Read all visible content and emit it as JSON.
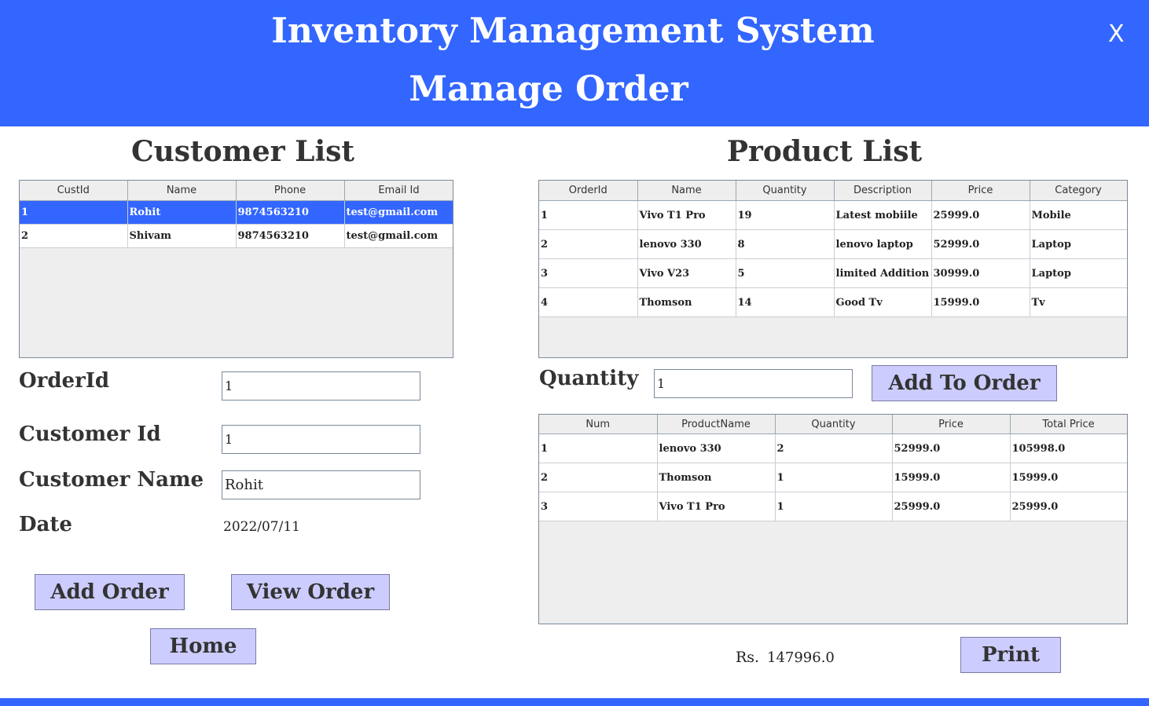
{
  "header": {
    "title": "Inventory Management System",
    "subtitle": "Manage Order",
    "close_label": "X",
    "color": "#3366ff"
  },
  "customer_list": {
    "title": "Customer List",
    "columns": [
      "CustId",
      "Name",
      "Phone",
      "Email Id"
    ],
    "rows": [
      [
        "1",
        "Rohit",
        "9874563210",
        "test@gmail.com"
      ],
      [
        "2",
        "Shivam",
        "9874563210",
        "test@gmail.com"
      ]
    ],
    "selected_row": 0
  },
  "product_list": {
    "title": "Product List",
    "columns": [
      "OrderId",
      "Name",
      "Quantity",
      "Description",
      "Price",
      "Category"
    ],
    "rows": [
      [
        "1",
        "Vivo T1 Pro",
        "19",
        "Latest mobiile",
        "25999.0",
        "Mobile"
      ],
      [
        "2",
        "lenovo 330",
        "8",
        "lenovo laptop",
        "52999.0",
        "Laptop"
      ],
      [
        "3",
        "Vivo V23",
        "5",
        "limited Addition",
        "30999.0",
        "Laptop"
      ],
      [
        "4",
        "Thomson",
        "14",
        "Good Tv",
        "15999.0",
        "Tv"
      ]
    ]
  },
  "form": {
    "order_id_label": "OrderId",
    "order_id_value": "1",
    "customer_id_label": "Customer Id",
    "customer_id_value": "1",
    "customer_name_label": "Customer Name",
    "customer_name_value": "Rohit",
    "date_label": "Date",
    "date_value": "2022/07/11"
  },
  "quantity": {
    "label": "Quantity",
    "value": "1"
  },
  "buttons": {
    "add_to_order": "Add To Order",
    "add_order": "Add Order",
    "view_order": "View Order",
    "home": "Home",
    "print": "Print"
  },
  "order_table": {
    "columns": [
      "Num",
      "ProductName",
      "Quantity",
      "Price",
      "Total Price"
    ],
    "rows": [
      [
        "1",
        "lenovo 330",
        "2",
        "52999.0",
        "105998.0"
      ],
      [
        "2",
        "Thomson",
        "1",
        "15999.0",
        "15999.0"
      ],
      [
        "3",
        "Vivo T1 Pro",
        "1",
        "25999.0",
        "25999.0"
      ]
    ]
  },
  "total": {
    "currency": "Rs.",
    "amount": "147996.0"
  }
}
